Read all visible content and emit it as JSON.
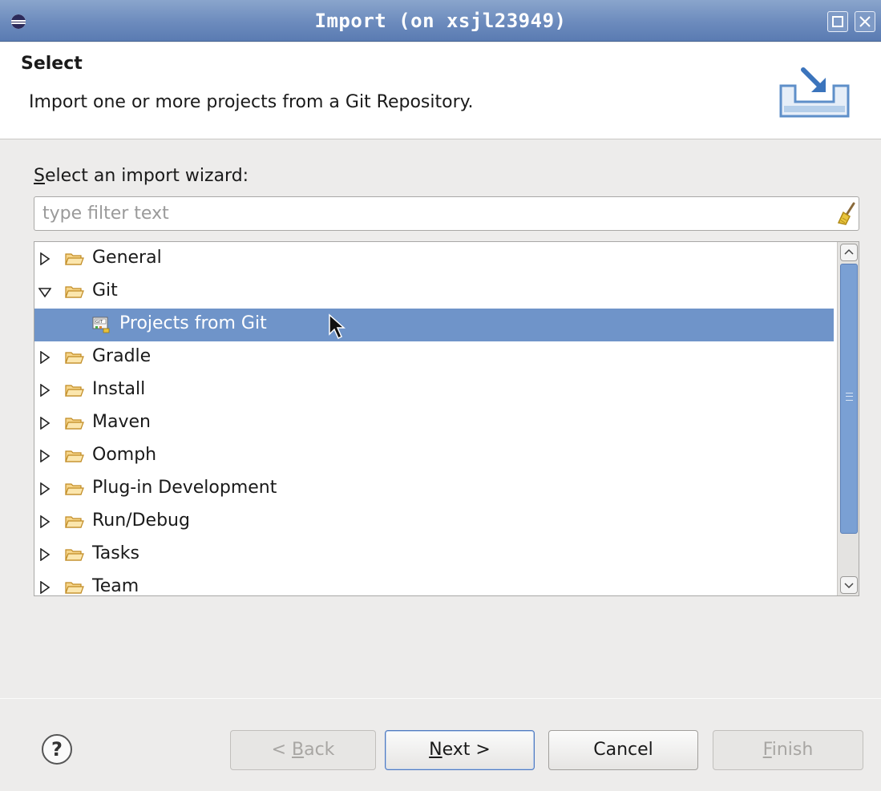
{
  "window": {
    "title": "Import  (on xsjl23949)"
  },
  "header": {
    "title": "Select",
    "description": "Import one or more projects from a Git Repository."
  },
  "wizard": {
    "label_mnemonic": "S",
    "label_rest": "elect an import wizard:",
    "filter_placeholder": "type filter text",
    "filter_value": ""
  },
  "tree": {
    "items": [
      {
        "label": "General",
        "expanded": false
      },
      {
        "label": "Git",
        "expanded": true
      },
      {
        "label": "Projects from Git",
        "selected": true
      },
      {
        "label": "Gradle",
        "expanded": false
      },
      {
        "label": "Install",
        "expanded": false
      },
      {
        "label": "Maven",
        "expanded": false
      },
      {
        "label": "Oomph",
        "expanded": false
      },
      {
        "label": "Plug-in Development",
        "expanded": false
      },
      {
        "label": "Run/Debug",
        "expanded": false
      },
      {
        "label": "Tasks",
        "expanded": false
      },
      {
        "label": "Team",
        "expanded": false
      }
    ]
  },
  "buttons": {
    "back_prefix": "< ",
    "back_mnemonic": "B",
    "back_rest": "ack",
    "next_mnemonic": "N",
    "next_rest": "ext >",
    "cancel": "Cancel",
    "finish_mnemonic": "F",
    "finish_rest": "inish",
    "help": "?"
  },
  "icons": {
    "title": "eclipse-icon",
    "banner": "import-wizard-icon",
    "clear_filter": "broom-icon",
    "folder": "folder-icon",
    "git": "git-icon",
    "help": "help-icon"
  },
  "colors": {
    "titlebar": "#6c8bbd",
    "selection": "#6f94c9",
    "scroll_thumb": "#7aa0d4"
  }
}
